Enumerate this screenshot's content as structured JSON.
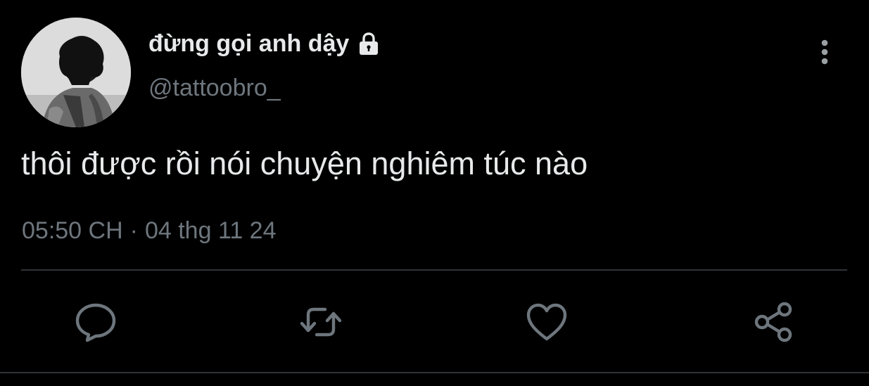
{
  "author": {
    "display_name": "đừng gọi anh dậy",
    "handle": "@tattoobro_",
    "protected_icon": "lock-icon",
    "avatar": "profile-photo"
  },
  "tweet": {
    "text": "thôi được rồi nói chuyện nghiêm túc nào",
    "time": "05:50 CH",
    "separator": "·",
    "date": "04 thg 11 24"
  },
  "actions": {
    "icons": [
      "reply-icon",
      "retweet-icon",
      "like-icon",
      "share-icon"
    ],
    "more_icon": "more-vertical-icon"
  },
  "colors": {
    "background": "#000000",
    "primary_text": "#e7e9ea",
    "secondary_text": "#6e767d",
    "divider": "#2f3336"
  }
}
